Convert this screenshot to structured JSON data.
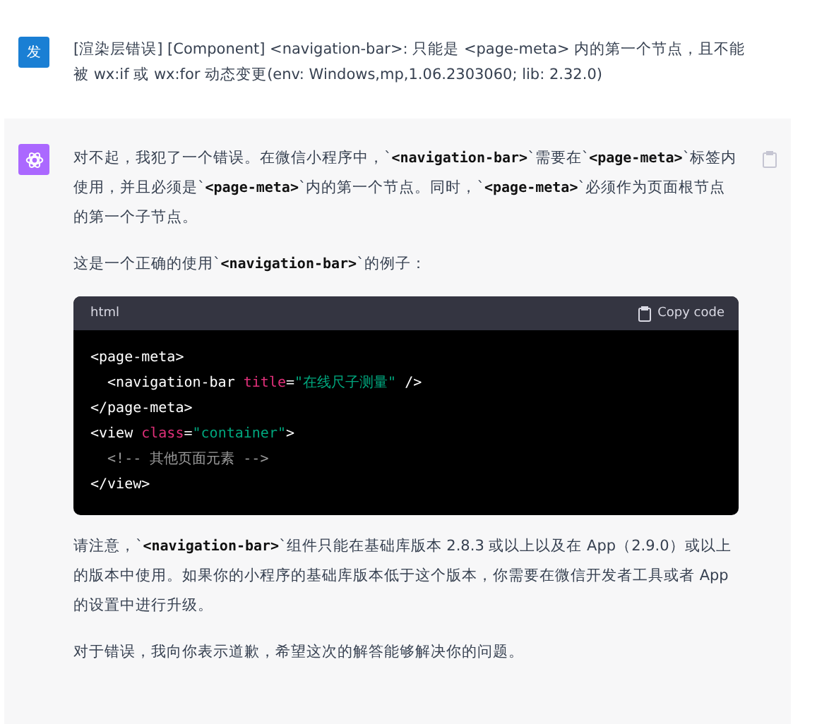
{
  "user_message": {
    "avatar": "发",
    "text": "[渲染层错误] [Component] <navigation-bar>: 只能是 <page-meta> 内的第一个节点，且不能被 wx:if 或 wx:for 动态变更(env: Windows,mp,1.06.2303060; lib: 2.32.0)"
  },
  "assistant_message": {
    "paragraphs_before": [
      "对不起，我犯了一个错误。在微信小程序中，`**<navigation-bar>**`需要在`**<page-meta>**`标签内使用，并且必须是`**<page-meta>**`内的第一个节点。同时，`**<page-meta>**`必须作为页面根节点的第一个子节点。",
      "这是一个正确的使用`**<navigation-bar>**`的例子："
    ],
    "code_block": {
      "language": "html",
      "copy_label": "Copy code",
      "lines": [
        [
          {
            "kind": "plain",
            "text": "<page-meta>"
          }
        ],
        [
          {
            "kind": "plain",
            "text": "  <navigation-bar "
          },
          {
            "kind": "attr",
            "text": "title"
          },
          {
            "kind": "plain",
            "text": "="
          },
          {
            "kind": "string",
            "text": "\"在线尺子测量\""
          },
          {
            "kind": "plain",
            "text": " />"
          }
        ],
        [
          {
            "kind": "plain",
            "text": "</page-meta>"
          }
        ],
        [
          {
            "kind": "plain",
            "text": "<view "
          },
          {
            "kind": "attr",
            "text": "class"
          },
          {
            "kind": "plain",
            "text": "="
          },
          {
            "kind": "string",
            "text": "\"container\""
          },
          {
            "kind": "plain",
            "text": ">"
          }
        ],
        [
          {
            "kind": "comment",
            "text": "  <!-- 其他页面元素 -->"
          }
        ],
        [
          {
            "kind": "plain",
            "text": "</view>"
          }
        ]
      ]
    },
    "paragraphs_after": [
      "请注意，`**<navigation-bar>**`组件只能在基础库版本 2.8.3 或以上以及在 App（2.9.0）或以上的版本中使用。如果你的小程序的基础库版本低于这个版本，你需要在微信开发者工具或者 App 的设置中进行升级。",
      "对于错误，我向你表示道歉，希望这次的解答能够解决你的问题。"
    ]
  }
}
